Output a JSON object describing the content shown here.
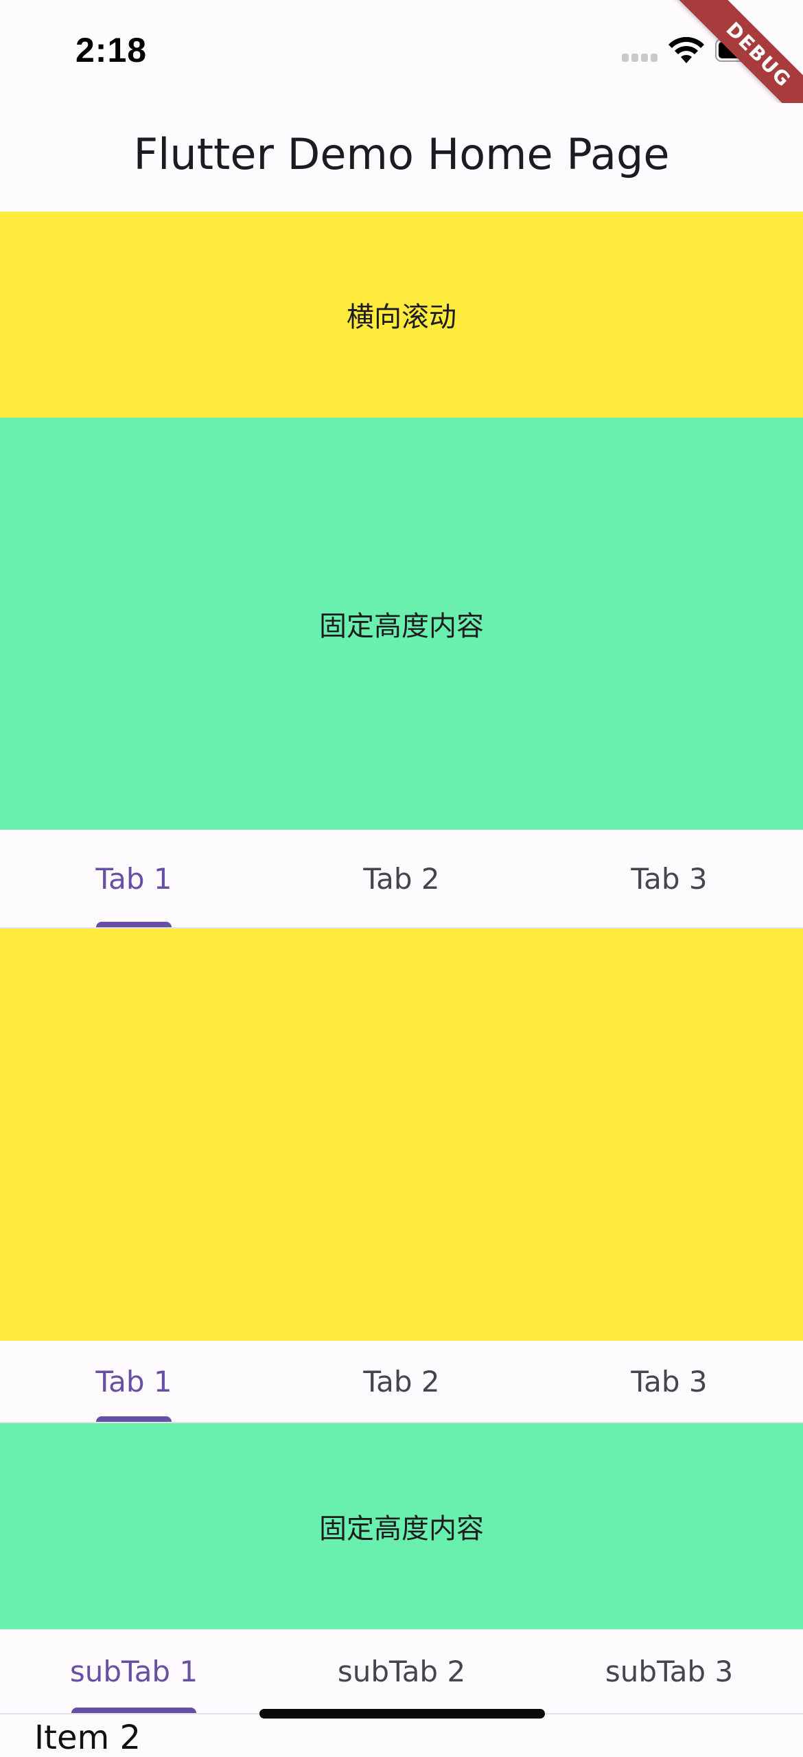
{
  "status_bar": {
    "time": "2:18",
    "icons": [
      "signal-icon",
      "wifi-icon",
      "battery-icon"
    ]
  },
  "debug_banner": {
    "label": "DEBUG"
  },
  "app_bar": {
    "title": "Flutter Demo Home Page"
  },
  "sections": {
    "horizontal_scroll": "横向滚动",
    "fixed_height_top": "固定高度内容",
    "fixed_height_mid": "固定高度内容"
  },
  "tab_bar_1": {
    "tabs": [
      "Tab 1",
      "Tab 2",
      "Tab 3"
    ],
    "selected": 0
  },
  "tab_bar_2": {
    "tabs": [
      "Tab 1",
      "Tab 2",
      "Tab 3"
    ],
    "selected": 0
  },
  "sub_tab_bar": {
    "tabs": [
      "subTab 1",
      "subTab 2",
      "subTab 3"
    ],
    "selected": 0
  },
  "list": {
    "items": [
      "Item 2"
    ]
  },
  "colors": {
    "yellow": "#ffeb3b",
    "green": "#69f0ae",
    "accent": "#6750a4",
    "debug": "#a83c3c"
  }
}
